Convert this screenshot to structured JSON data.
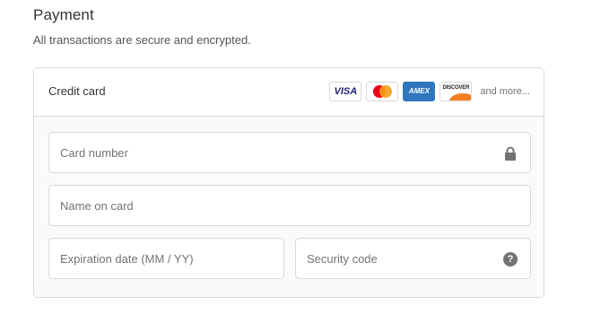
{
  "section": {
    "title": "Payment",
    "subtitle": "All transactions are secure and encrypted."
  },
  "payment_method": {
    "label": "Credit card",
    "brands": [
      {
        "name": "VISA",
        "icon": "visa-logo"
      },
      {
        "name": "Mastercard",
        "icon": "mastercard-logo"
      },
      {
        "name": "AMEX",
        "icon": "amex-logo"
      },
      {
        "name": "DISCOVER",
        "icon": "discover-logo"
      }
    ],
    "more_text": "and more..."
  },
  "fields": {
    "card_number": {
      "placeholder": "Card number",
      "value": "",
      "icon": "lock-icon"
    },
    "name_on_card": {
      "placeholder": "Name on card",
      "value": ""
    },
    "expiration": {
      "placeholder": "Expiration date (MM / YY)",
      "value": ""
    },
    "security_code": {
      "placeholder": "Security code",
      "value": "",
      "icon": "help-icon",
      "help_glyph": "?"
    }
  },
  "colors": {
    "border": "#d9d9d9",
    "body_bg": "#fafafa",
    "placeholder": "#737373",
    "amex": "#2e77bc",
    "visa": "#1a1f71",
    "mc_red": "#eb001b",
    "mc_yellow": "#f79e1b",
    "discover_orange": "#f48120"
  }
}
